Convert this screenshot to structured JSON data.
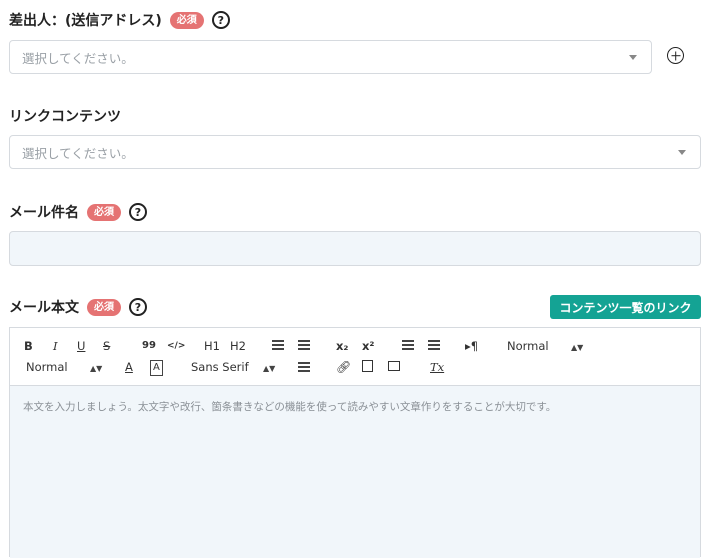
{
  "sender": {
    "label": "差出人：(送信アドレス)",
    "badge": "必須",
    "help": "?",
    "placeholder": "選択してください。"
  },
  "link_contents": {
    "label": "リンクコンテンツ",
    "placeholder": "選択してください。"
  },
  "subject": {
    "label": "メール件名",
    "badge": "必須",
    "help": "?",
    "value": ""
  },
  "body": {
    "label": "メール本文",
    "badge": "必須",
    "help": "?",
    "link_button": "コンテンツ一覧のリンク",
    "placeholder": "本文を入力しましょう。太文字や改行、箇条書きなどの機能を使って読みやすい文章作りをすることが大切です。"
  },
  "toolbar": {
    "bold": "B",
    "italic": "I",
    "underline": "U",
    "strike": "S",
    "blockquote": "99",
    "code": "</>",
    "h1": "H1",
    "h2": "H2",
    "subscript": "x₂",
    "superscript": "x²",
    "direction": "▸¶",
    "size_select": "Normal",
    "header_select": "Normal",
    "font_color": "A",
    "bg_color": "A",
    "font_select": "Sans Serif",
    "clean": "Tx"
  },
  "colors": {
    "badge": "#e57373",
    "accent": "#14a394",
    "input_bg": "#f1f6fa",
    "border": "#d6dadf"
  }
}
